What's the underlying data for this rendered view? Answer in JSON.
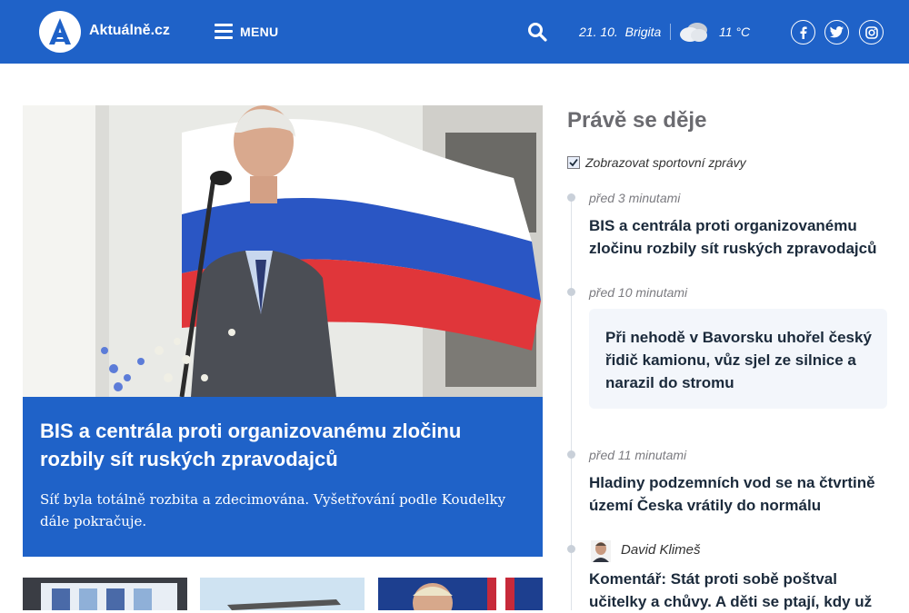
{
  "header": {
    "brand": "Aktuálně.cz",
    "menu_label": "MENU",
    "date": "21. 10.",
    "nameday": "Brigita",
    "temperature": "11 °C",
    "icons": [
      "logo-a",
      "burger-icon",
      "search-icon",
      "cloud-icon",
      "facebook-icon",
      "twitter-icon",
      "instagram-icon"
    ],
    "colors": {
      "primary": "#1f62c8",
      "text_dark": "#1b2a3b"
    }
  },
  "lead": {
    "title": "BIS a centrála proti organizovanému zločinu rozbily sít ruských zpravodajců",
    "perex": "Síť byla totálně rozbita a zdecimována. Vyšetřování podle Koudelky dále pokračuje."
  },
  "sidebar": {
    "title": "Právě se děje",
    "sport_toggle_label": "Zobrazovat sportovní zprávy",
    "sport_toggle_checked": true,
    "items": [
      {
        "ago": "před 3 minutami",
        "title": "BIS a centrála proti organizovanému zločinu rozbily sít ruských zpravodajců"
      },
      {
        "ago": "před 10 minutami",
        "title": "Při nehodě v Bavorsku uhořel český řidič kamionu, vůz sjel ze silnice a narazil do stromu"
      },
      {
        "ago": "před 11 minutami",
        "title": "Hladiny podzemních vod se na čtvrtině území Česka vrátily do normálu"
      },
      {
        "author": "David Klimeš",
        "title": "Komentář: Stát proti sobě poštval učitelky a chůvy. A děti se ptají, kdy už"
      }
    ]
  }
}
